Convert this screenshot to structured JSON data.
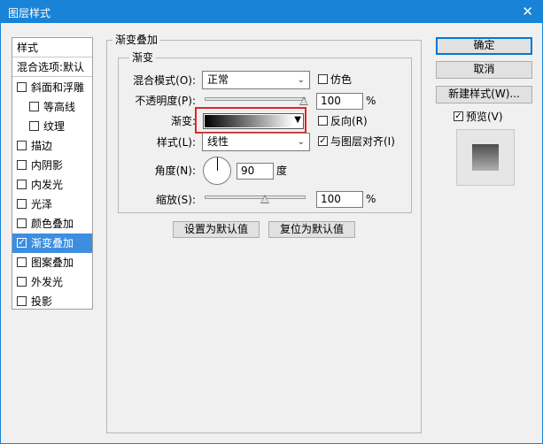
{
  "window": {
    "title": "图层样式",
    "close_glyph": "✕"
  },
  "sidebar": {
    "header": "样式",
    "blend_default": "混合选项:默认",
    "items": [
      {
        "label": "斜面和浮雕",
        "checked": false
      },
      {
        "label": "等高线",
        "checked": false
      },
      {
        "label": "纹理",
        "checked": false
      },
      {
        "label": "描边",
        "checked": false
      },
      {
        "label": "内阴影",
        "checked": false
      },
      {
        "label": "内发光",
        "checked": false
      },
      {
        "label": "光泽",
        "checked": false
      },
      {
        "label": "颜色叠加",
        "checked": false
      },
      {
        "label": "渐变叠加",
        "checked": true
      },
      {
        "label": "图案叠加",
        "checked": false
      },
      {
        "label": "外发光",
        "checked": false
      },
      {
        "label": "投影",
        "checked": false
      }
    ]
  },
  "panel": {
    "group_title": "渐变叠加",
    "subgroup_title": "渐变",
    "blend_mode_label": "混合模式(O):",
    "blend_mode_value": "正常",
    "dither_label": "仿色",
    "opacity_label": "不透明度(P):",
    "opacity_value": "100",
    "opacity_unit": "%",
    "gradient_label": "渐变:",
    "reverse_label": "反向(R)",
    "style_label": "样式(L):",
    "style_value": "线性",
    "align_label": "与图层对齐(I)",
    "angle_label": "角度(N):",
    "angle_value": "90",
    "angle_unit": "度",
    "scale_label": "缩放(S):",
    "scale_value": "100",
    "scale_unit": "%",
    "make_default_button": "设置为默认值",
    "reset_default_button": "复位为默认值"
  },
  "right": {
    "ok_button": "确定",
    "cancel_button": "取消",
    "new_style_button": "新建样式(W)...",
    "preview_label": "预览(V)",
    "preview_checked": true
  },
  "colors": {
    "titlebar": "#1883d7",
    "selection": "#3d8ee0",
    "highlight_box": "#e2232a"
  },
  "icons": {
    "checkbox_check": "✓",
    "dropdown": "▼"
  }
}
